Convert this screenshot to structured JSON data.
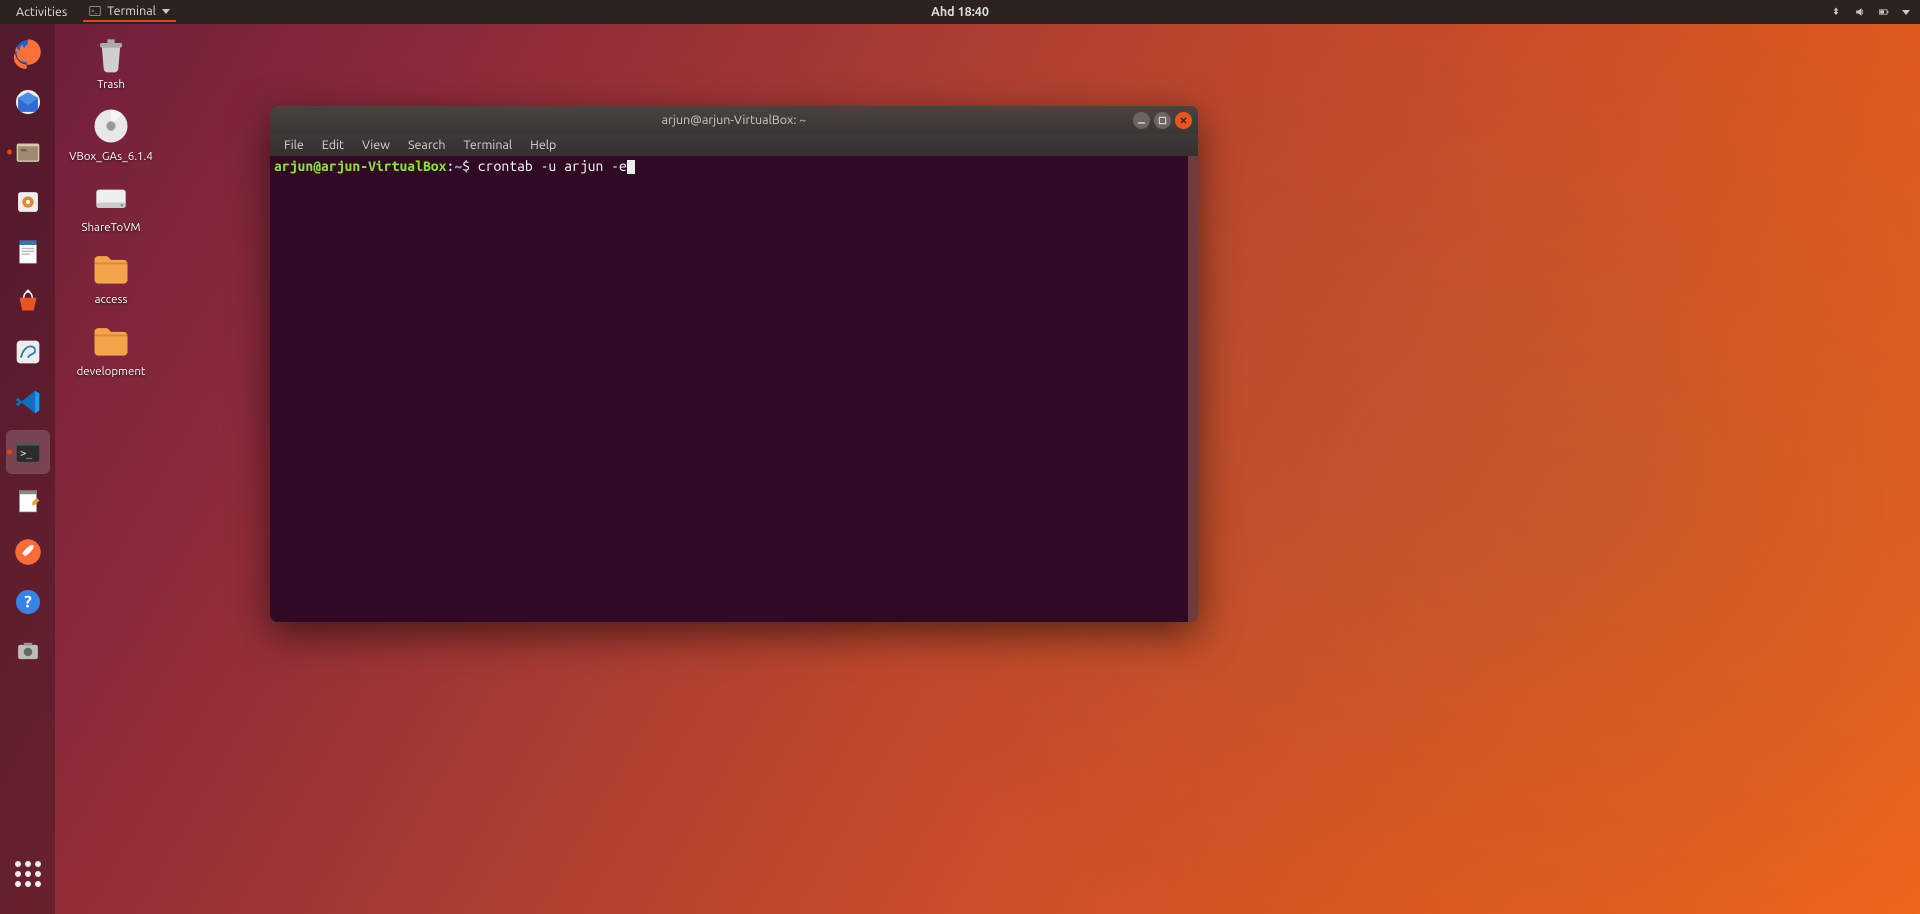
{
  "topbar": {
    "activities": "Activities",
    "active_app": "Terminal",
    "clock": "Ahd 18:40"
  },
  "desktop": [
    {
      "label": "Trash"
    },
    {
      "label": "VBox_GAs_6.1.4"
    },
    {
      "label": "ShareToVM"
    },
    {
      "label": "access"
    },
    {
      "label": "development"
    }
  ],
  "window": {
    "title": "arjun@arjun-VirtualBox: ~",
    "menu": [
      "File",
      "Edit",
      "View",
      "Search",
      "Terminal",
      "Help"
    ],
    "prompt": {
      "userhost": "arjun@arjun-VirtualBox",
      "sep": ":",
      "path": "~",
      "dollar": "$",
      "command": "crontab -u arjun -e"
    }
  }
}
